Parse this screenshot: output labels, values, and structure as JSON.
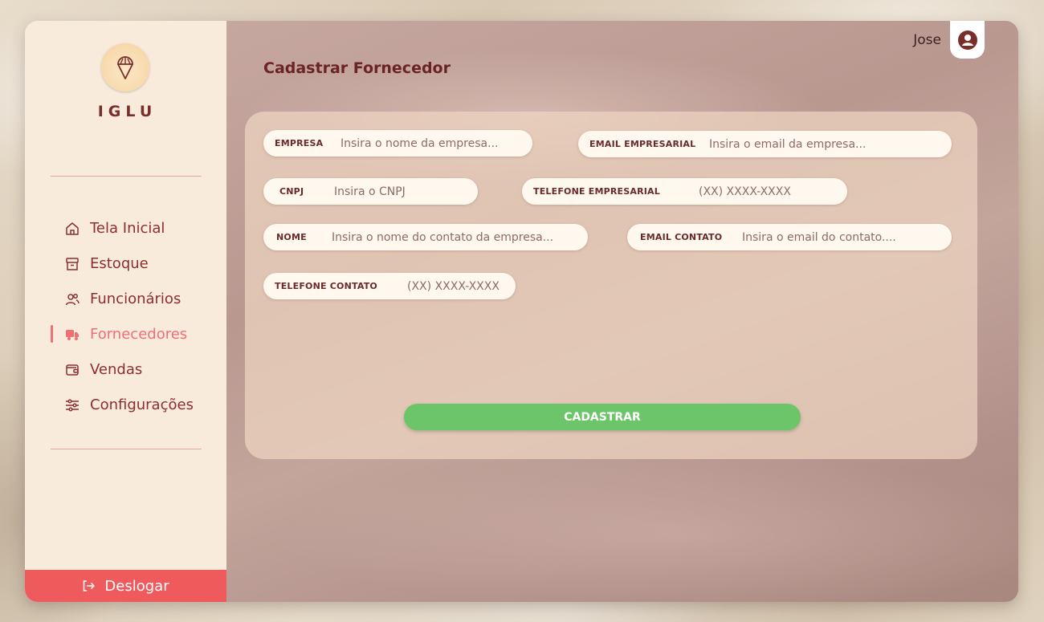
{
  "brand": {
    "name": "IGLU"
  },
  "nav": {
    "items": [
      {
        "label": "Tela Inicial"
      },
      {
        "label": "Estoque"
      },
      {
        "label": "Funcionários"
      },
      {
        "label": "Fornecedores"
      },
      {
        "label": "Vendas"
      },
      {
        "label": "Configurações"
      }
    ],
    "active": "Fornecedores",
    "logout_label": "Deslogar"
  },
  "header": {
    "username": "Jose"
  },
  "page": {
    "title": "Cadastrar Fornecedor"
  },
  "form": {
    "empresa": {
      "label": "EMPRESA",
      "placeholder": "Insira o nome da empresa..."
    },
    "email_empresarial": {
      "label": "EMAIL EMPRESARIAL",
      "placeholder": "Insira o email da empresa..."
    },
    "cnpj": {
      "label": "CNPJ",
      "placeholder": "Insira o CNPJ"
    },
    "telefone_empresarial": {
      "label": "TELEFONE EMPRESARIAL",
      "placeholder": "(XX) XXXX-XXXX"
    },
    "nome": {
      "label": "NOME",
      "placeholder": "Insira o nome do contato da empresa..."
    },
    "email_contato": {
      "label": "EMAIL CONTATO",
      "placeholder": "Insira o email do contato...."
    },
    "telefone_contato": {
      "label": "TELEFONE CONTATO",
      "placeholder": "(XX) XXXX-XXXX"
    },
    "submit_label": "CADASTRAR"
  },
  "colors": {
    "accent": "#ef6f73",
    "logout": "#ef5a5d",
    "submit": "#6cc569",
    "text_dark": "#8a2f2e"
  },
  "icons": [
    "ice-cream-icon",
    "home-icon",
    "box-icon",
    "users-icon",
    "truck-icon",
    "wallet-icon",
    "sliders-icon",
    "logout-icon",
    "user-icon"
  ]
}
